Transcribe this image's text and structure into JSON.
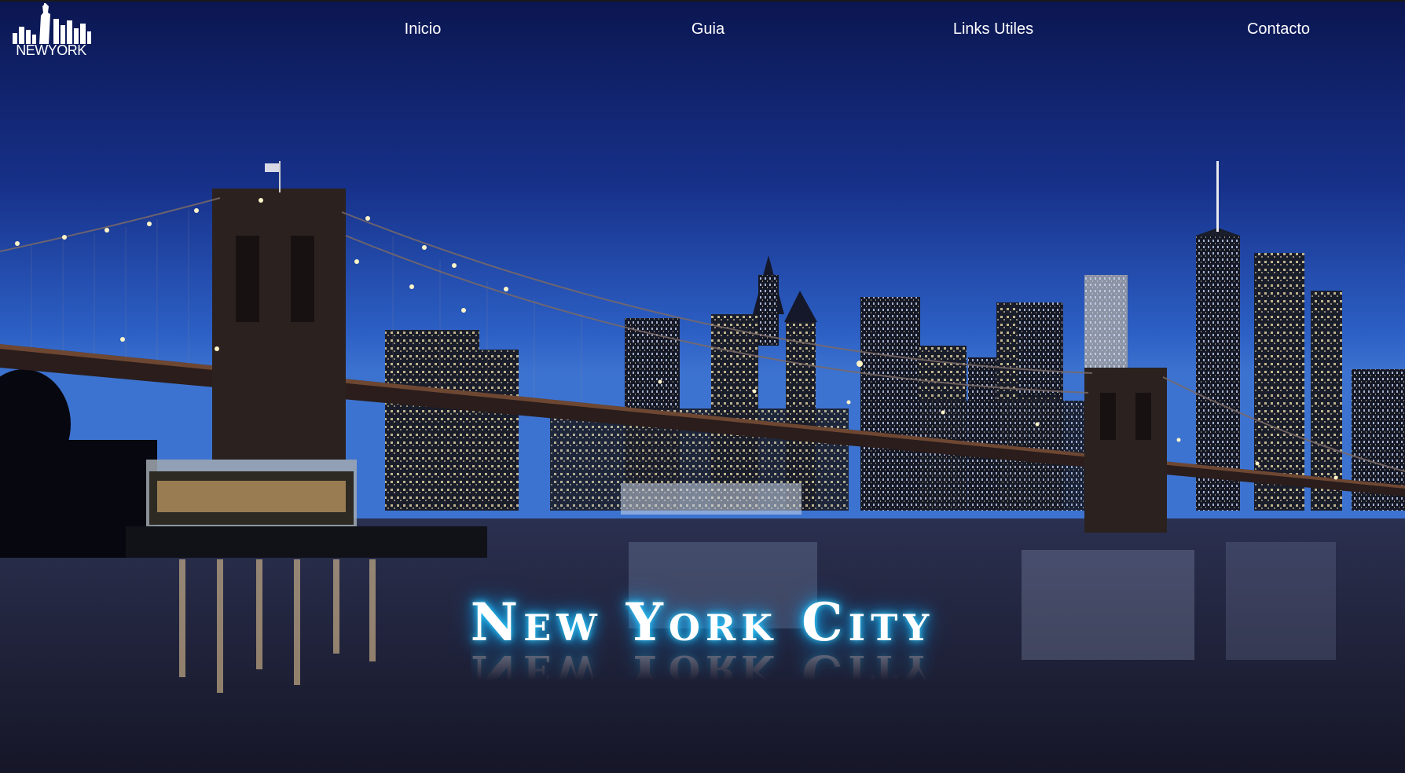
{
  "logo": {
    "text": "NEWYORK",
    "icon": "skyline-statue-of-liberty-icon"
  },
  "nav": {
    "items": [
      {
        "label": "Inicio"
      },
      {
        "label": "Guia"
      },
      {
        "label": "Links Utiles"
      },
      {
        "label": "Contacto"
      }
    ]
  },
  "hero": {
    "title": "New York City",
    "image": "brooklyn-bridge-manhattan-skyline-night-photo"
  },
  "colors": {
    "sky_top": "#0c1a5e",
    "sky_horizon": "#2d63c8",
    "water": "#1f2238",
    "glow": "#18b4ff",
    "text": "#ffffff"
  }
}
